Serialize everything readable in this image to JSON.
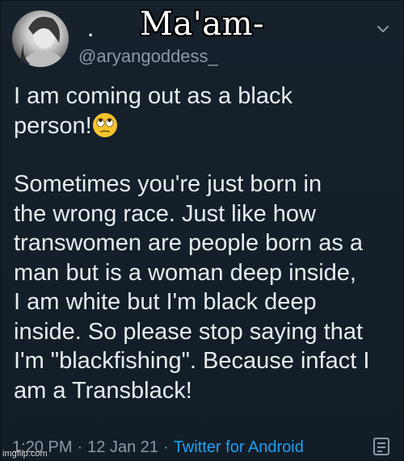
{
  "meme": {
    "caption": "Ma'am-"
  },
  "tweet": {
    "display_name": ".",
    "handle": "@aryangoddess_",
    "paragraphs": [
      "I am coming out as a black\nperson!",
      "Sometimes you're just born in\nthe wrong race. Just like how\ntranswomen are people born as a\nman but is a woman deep inside,\nI am white but I'm black deep\ninside. So please stop saying that\nI'm \"blackfishing\". Because infact I\nam a Transblack!"
    ],
    "emoji": "rolling-eyes-emoji",
    "time": "1:20 PM",
    "separator": "·",
    "date": "12 Jan 21",
    "source": "Twitter for Android"
  },
  "icons": {
    "chevron": "chevron-down-icon",
    "analytics": "analytics-icon"
  },
  "watermark": "imgflip.com",
  "colors": {
    "background": "#15202b",
    "text": "#e7ecef",
    "muted": "#8b98a5",
    "link": "#1da1f2"
  }
}
